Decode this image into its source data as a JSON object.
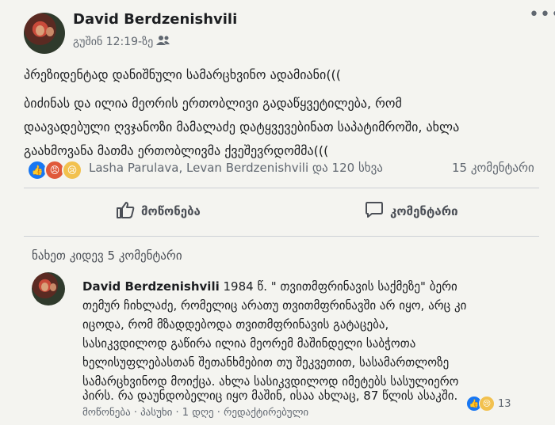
{
  "post": {
    "author": "David Berdzenishvili",
    "timestamp": "გუშინ 12:19-ზე",
    "audience_icon": "friends-icon",
    "more_icon": "ellipsis-icon",
    "text_line_1": "პრეზიდენტად დანიშნული სამარცხვინო ადამიანი(((",
    "text_line_2": "ბიძინას და ილია მეორის ერთობლივი გადაწყვეტილება, რომ",
    "text_line_3": "დაავადებული ღვჯანოზი მამალაძე დატყვევებინათ საპატიმროში, ახლა",
    "text_line_4": "გაახმოვანა მათმა ერთობლივმა ქვეშევრდომმა(((",
    "reaction_names": "Lasha Parulava, Levan Berdzenishvili და 120 სხვა",
    "comment_count": "15 კომენტარი",
    "like_label": "მოწონება",
    "comment_label": "კომენტარი"
  },
  "comments": {
    "view_more": "ნახეთ კიდევ 5 კომენტარი",
    "items": [
      {
        "author": "David Berdzenishvili",
        "line_1": " 1984 წ. \" თვითმფრინავის საქმეზე\" ბერი",
        "line_2": "თემურ ჩიხლაძე, რომელიც არათუ თვითმფრინავში არ იყო, არც კი",
        "line_3": "იცოდა, რომ მზადდებოდა თვითმფრინავის გატაცება,",
        "line_4": "სასიკვდილოდ გაწირა ილია მეორემ მაშინდელი საბჭოთა",
        "line_5": "ხელისუფლებასთან შეთანხმებით თუ შეკვეთით, სასამართლოზე",
        "line_6": "სამარცხვინოდ მოიქცა. ახლა სასიკვდილოდ იმეტებს სასულიერო",
        "line_7": "პირს. რა დაუნდობელიც იყო მაშინ, ისაა ახლაც, 87 წლის ასაკში.",
        "actions": "მოწონება · პასუხი · 1 დღე · რედაქტირებული",
        "reaction_count": "13"
      }
    ]
  },
  "colors": {
    "like": "#1877f2",
    "angry": "#e0583a",
    "sad": "#f2c14e"
  }
}
